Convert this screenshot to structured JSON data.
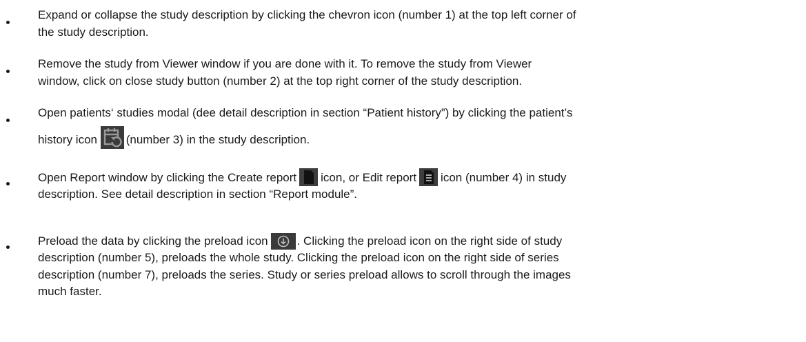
{
  "bullets": [
    {
      "lines": [
        "Expand or collapse the study description by clicking the chevron icon (number 1) at the top left corner of",
        "the study description."
      ]
    },
    {
      "lines": [
        "Remove the study from Viewer window if you are done with it. To remove the study from Viewer",
        "window, click on close study button (number 2) at the top right corner of the study description."
      ]
    },
    {
      "line1": "Open patients‘ studies modal (dee detail description in section “Patient history”) by clicking the patient’s",
      "line2_before": "history icon",
      "icon": "patient-history-icon",
      "line2_after": " (number 3) in the study description."
    },
    {
      "line1_before": "Open Report window by clicking the Create report",
      "icon_create": "create-report-icon",
      "line1_middle": "icon, or Edit report",
      "icon_edit": "edit-report-icon",
      "line1_after": "icon (number 4) in study",
      "line2": "description. See detail description in section “Report module”."
    },
    {
      "line1_before": "Preload the data by clicking the preload icon",
      "icon": "preload-icon",
      "line1_after": ". Clicking the preload icon on the right side of study",
      "lines": [
        "description (number 5), preloads the whole study. Clicking the preload icon on the right side of series",
        "description (number 7), preloads the series. Study or series preload allows to scroll through the images",
        "much faster."
      ]
    }
  ]
}
